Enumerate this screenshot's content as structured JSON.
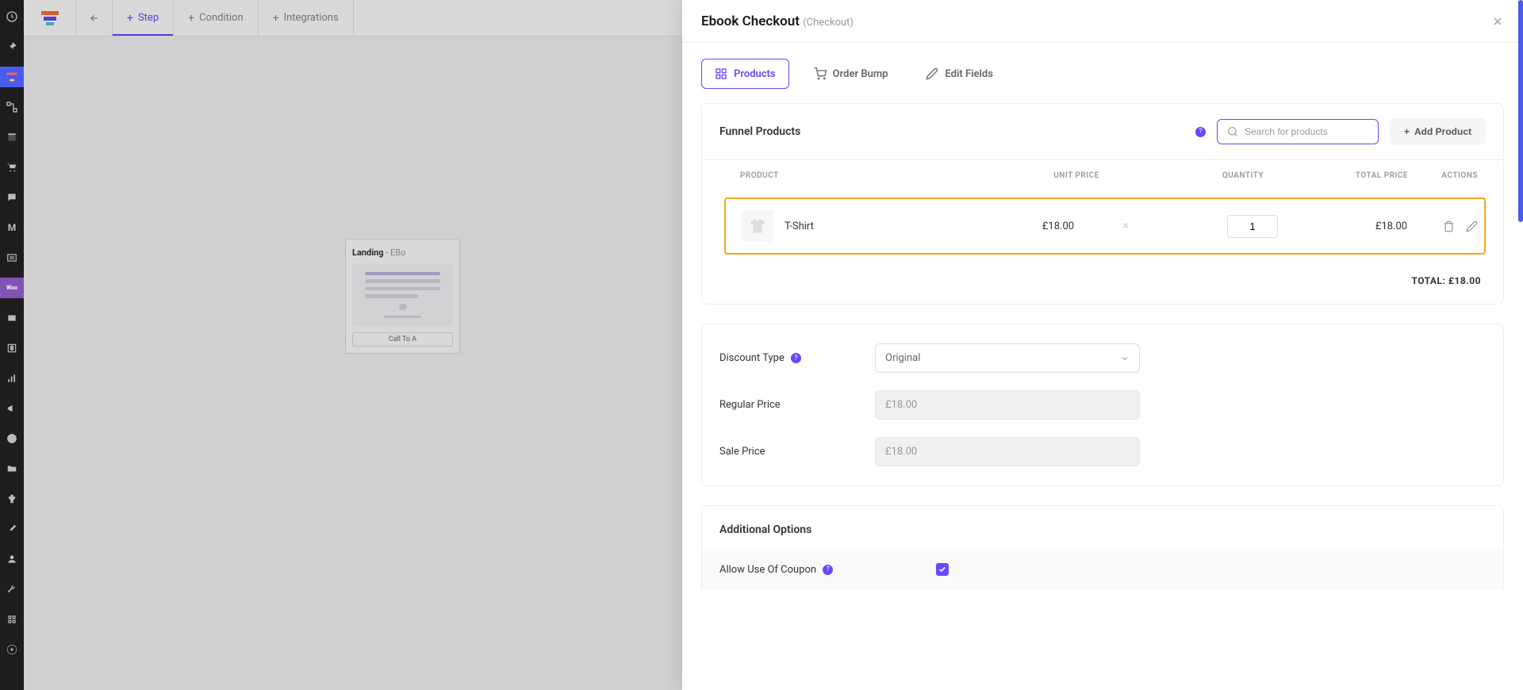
{
  "toolbar": {
    "tabs": [
      "Step",
      "Condition",
      "Integrations"
    ]
  },
  "canvas": {
    "landing_title": "Landing",
    "landing_sub": " - EBo",
    "landing_cta": "Call To A"
  },
  "modal": {
    "title": "Ebook Checkout",
    "subtitle": "(Checkout)",
    "tabs": {
      "products": "Products",
      "order_bump": "Order Bump",
      "edit_fields": "Edit Fields"
    },
    "products_section": {
      "title": "Funnel Products",
      "search_placeholder": "Search for products",
      "add_product": "Add Product",
      "columns": {
        "product": "PRODUCT",
        "unit_price": "UNIT PRICE",
        "quantity": "QUANTITY",
        "total_price": "TOTAL PRICE",
        "actions": "ACTIONS"
      },
      "rows": [
        {
          "name": "T-Shirt",
          "unit_price": "£18.00",
          "qty": "1",
          "total": "£18.00"
        }
      ],
      "grand_total_label": "TOTAL: ",
      "grand_total": "£18.00"
    },
    "discount": {
      "type_label": "Discount Type",
      "type_value": "Original",
      "regular_label": "Regular Price",
      "regular_value": "£18.00",
      "sale_label": "Sale Price",
      "sale_value": "£18.00"
    },
    "additional": {
      "title": "Additional Options",
      "coupon_label": "Allow Use Of Coupon"
    }
  }
}
